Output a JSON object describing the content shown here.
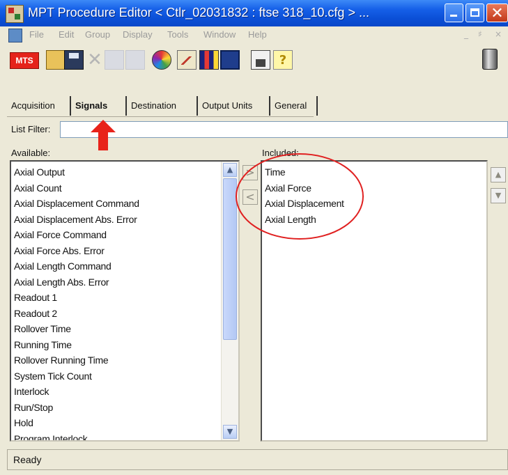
{
  "window": {
    "title": "MPT Procedure Editor  < Ctlr_02031832 : ftse 318_10.cfg > ...",
    "minimize_icon": "minimize-icon",
    "maximize_icon": "maximize-icon",
    "close_glyph": "✕"
  },
  "menu": {
    "items": [
      "File",
      "Edit",
      "Group",
      "Display",
      "Tools",
      "Window",
      "Help"
    ],
    "mdi_controls": [
      "_",
      "♯",
      "×"
    ]
  },
  "toolbar": {
    "logo_text": "MTS",
    "icons": [
      "mts-logo-icon",
      "open-folder-icon",
      "save-disk-icon",
      "delete-x-icon",
      "disabled-group-icon",
      "disabled-group2-icon",
      "color-palette-icon",
      "chart-icon",
      "signal-bars-icon",
      "station-icon",
      "lock-icon",
      "help-icon",
      "trash-can-icon"
    ],
    "delete_glyph": "✕",
    "help_glyph": "?"
  },
  "tabs": [
    "Acquisition",
    "Signals",
    "Destination",
    "Output Units",
    "General"
  ],
  "active_tab": "Signals",
  "filter": {
    "label": "List Filter:",
    "value": ""
  },
  "available": {
    "label": "Available:",
    "items": [
      "Axial Output",
      "Axial Count",
      "Axial Displacement Command",
      "Axial Displacement Abs. Error",
      "Axial Force Command",
      "Axial Force Abs. Error",
      "Axial Length Command",
      "Axial Length Abs. Error",
      "Readout 1",
      "Readout 2",
      "Rollover Time",
      "Running Time",
      "Rollover Running Time",
      "System Tick Count",
      "Interlock",
      "Run/Stop",
      "Hold",
      "Program Interlock"
    ],
    "scroll_up": "▲",
    "scroll_down": "▼"
  },
  "transfer": {
    "add_glyph": ">",
    "remove_glyph": "<"
  },
  "included": {
    "label": "Included:",
    "items": [
      "Time",
      "Axial Force",
      "Axial Displacement",
      "Axial Length"
    ],
    "move_up": "▲",
    "move_down": "▼"
  },
  "annotation_colors": {
    "arrow": "#e8231a",
    "ellipse": "#e02020"
  },
  "status": {
    "text": "Ready"
  }
}
